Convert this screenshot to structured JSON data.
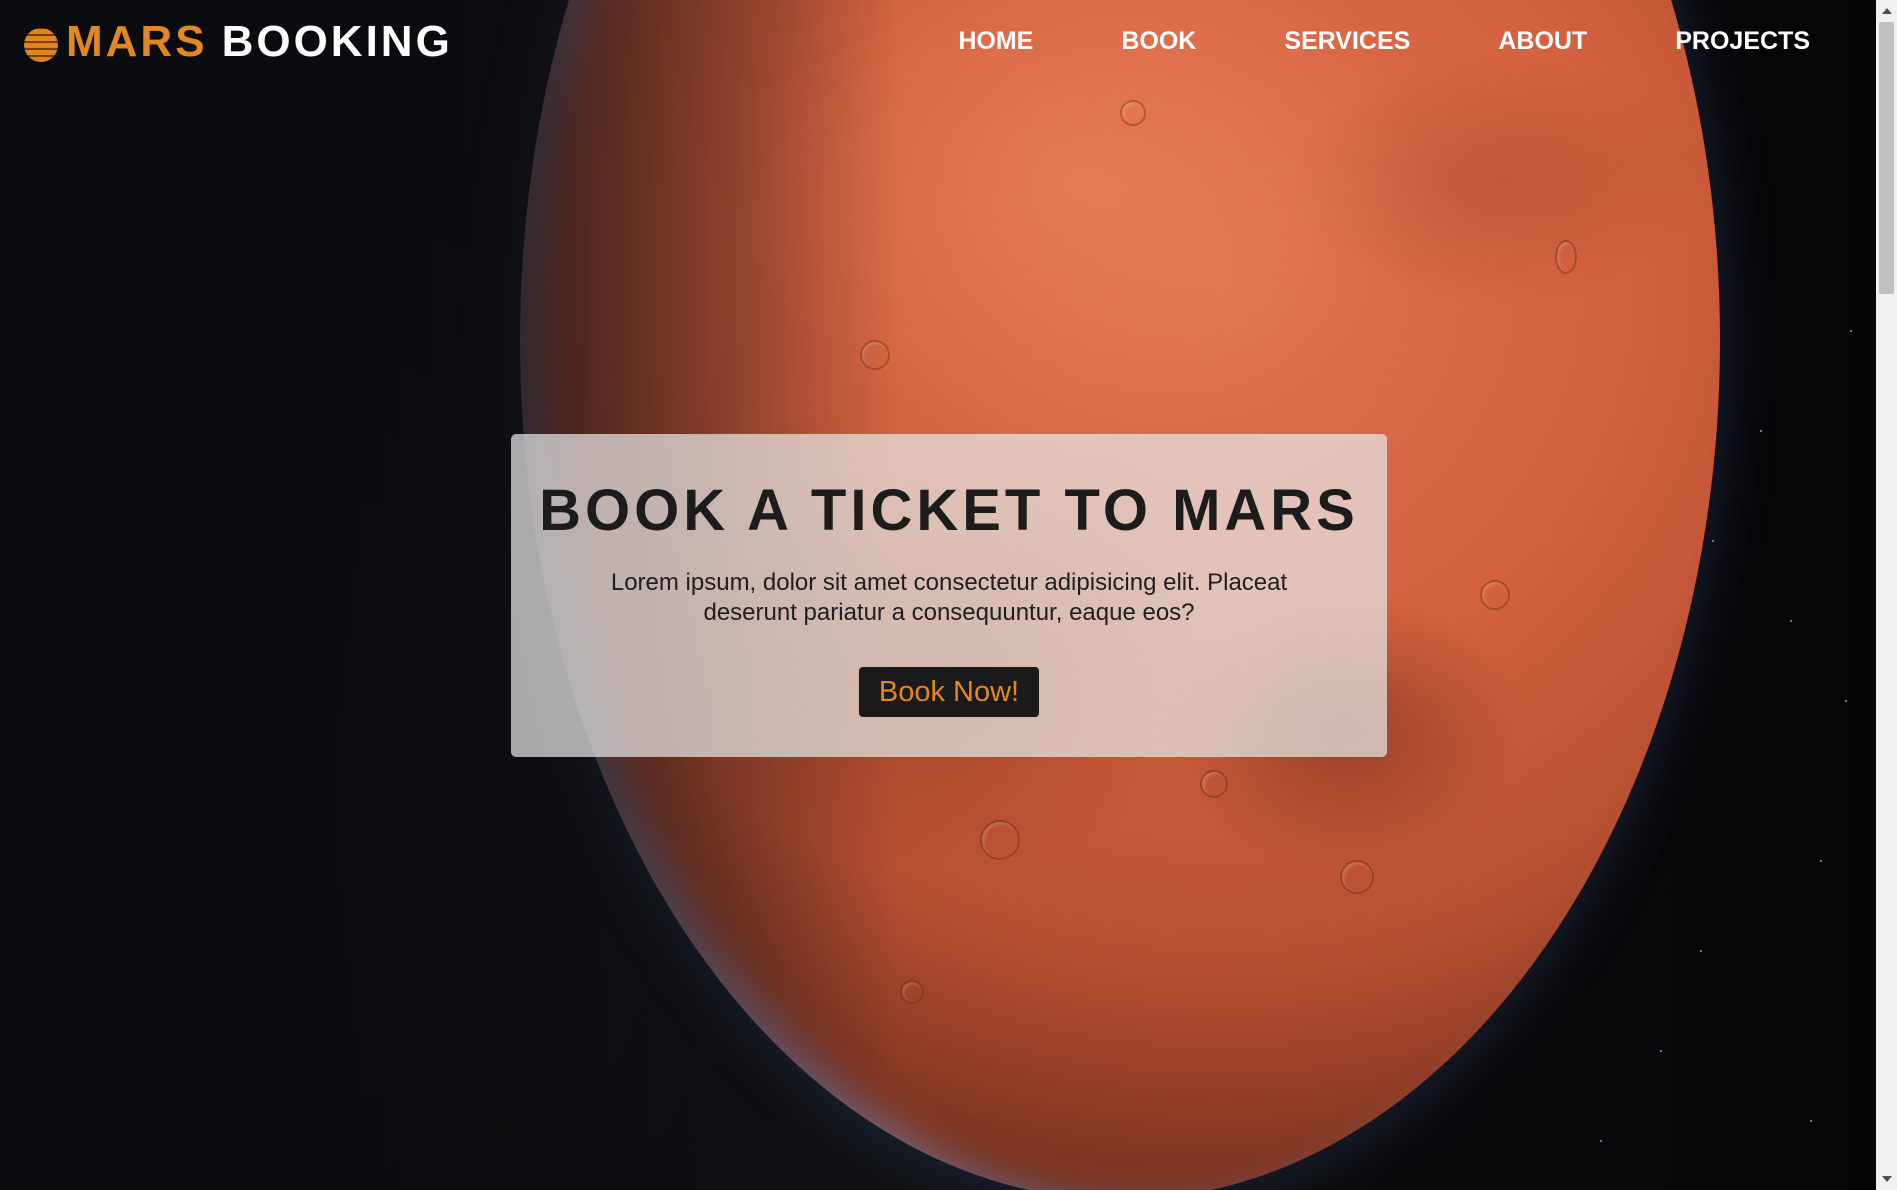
{
  "brand": {
    "mars": "MARS",
    "booking": "BOOKING"
  },
  "nav": [
    {
      "label": "HOME"
    },
    {
      "label": "BOOK"
    },
    {
      "label": "SERVICES"
    },
    {
      "label": "ABOUT"
    },
    {
      "label": "PROJECTS"
    }
  ],
  "hero": {
    "title": "BOOK A TICKET TO MARS",
    "text": "Lorem ipsum, dolor sit amet consectetur adipisicing elit. Placeat deserunt pariatur a consequuntur, eaque eos?",
    "button": "Book Now!"
  },
  "colors": {
    "accent": "#e38720",
    "dark": "#1a1a1a",
    "planet": "#d4613f"
  },
  "icons": {
    "logo": "planet-icon",
    "scroll_up": "arrow-up-icon",
    "scroll_down": "arrow-down-icon"
  }
}
